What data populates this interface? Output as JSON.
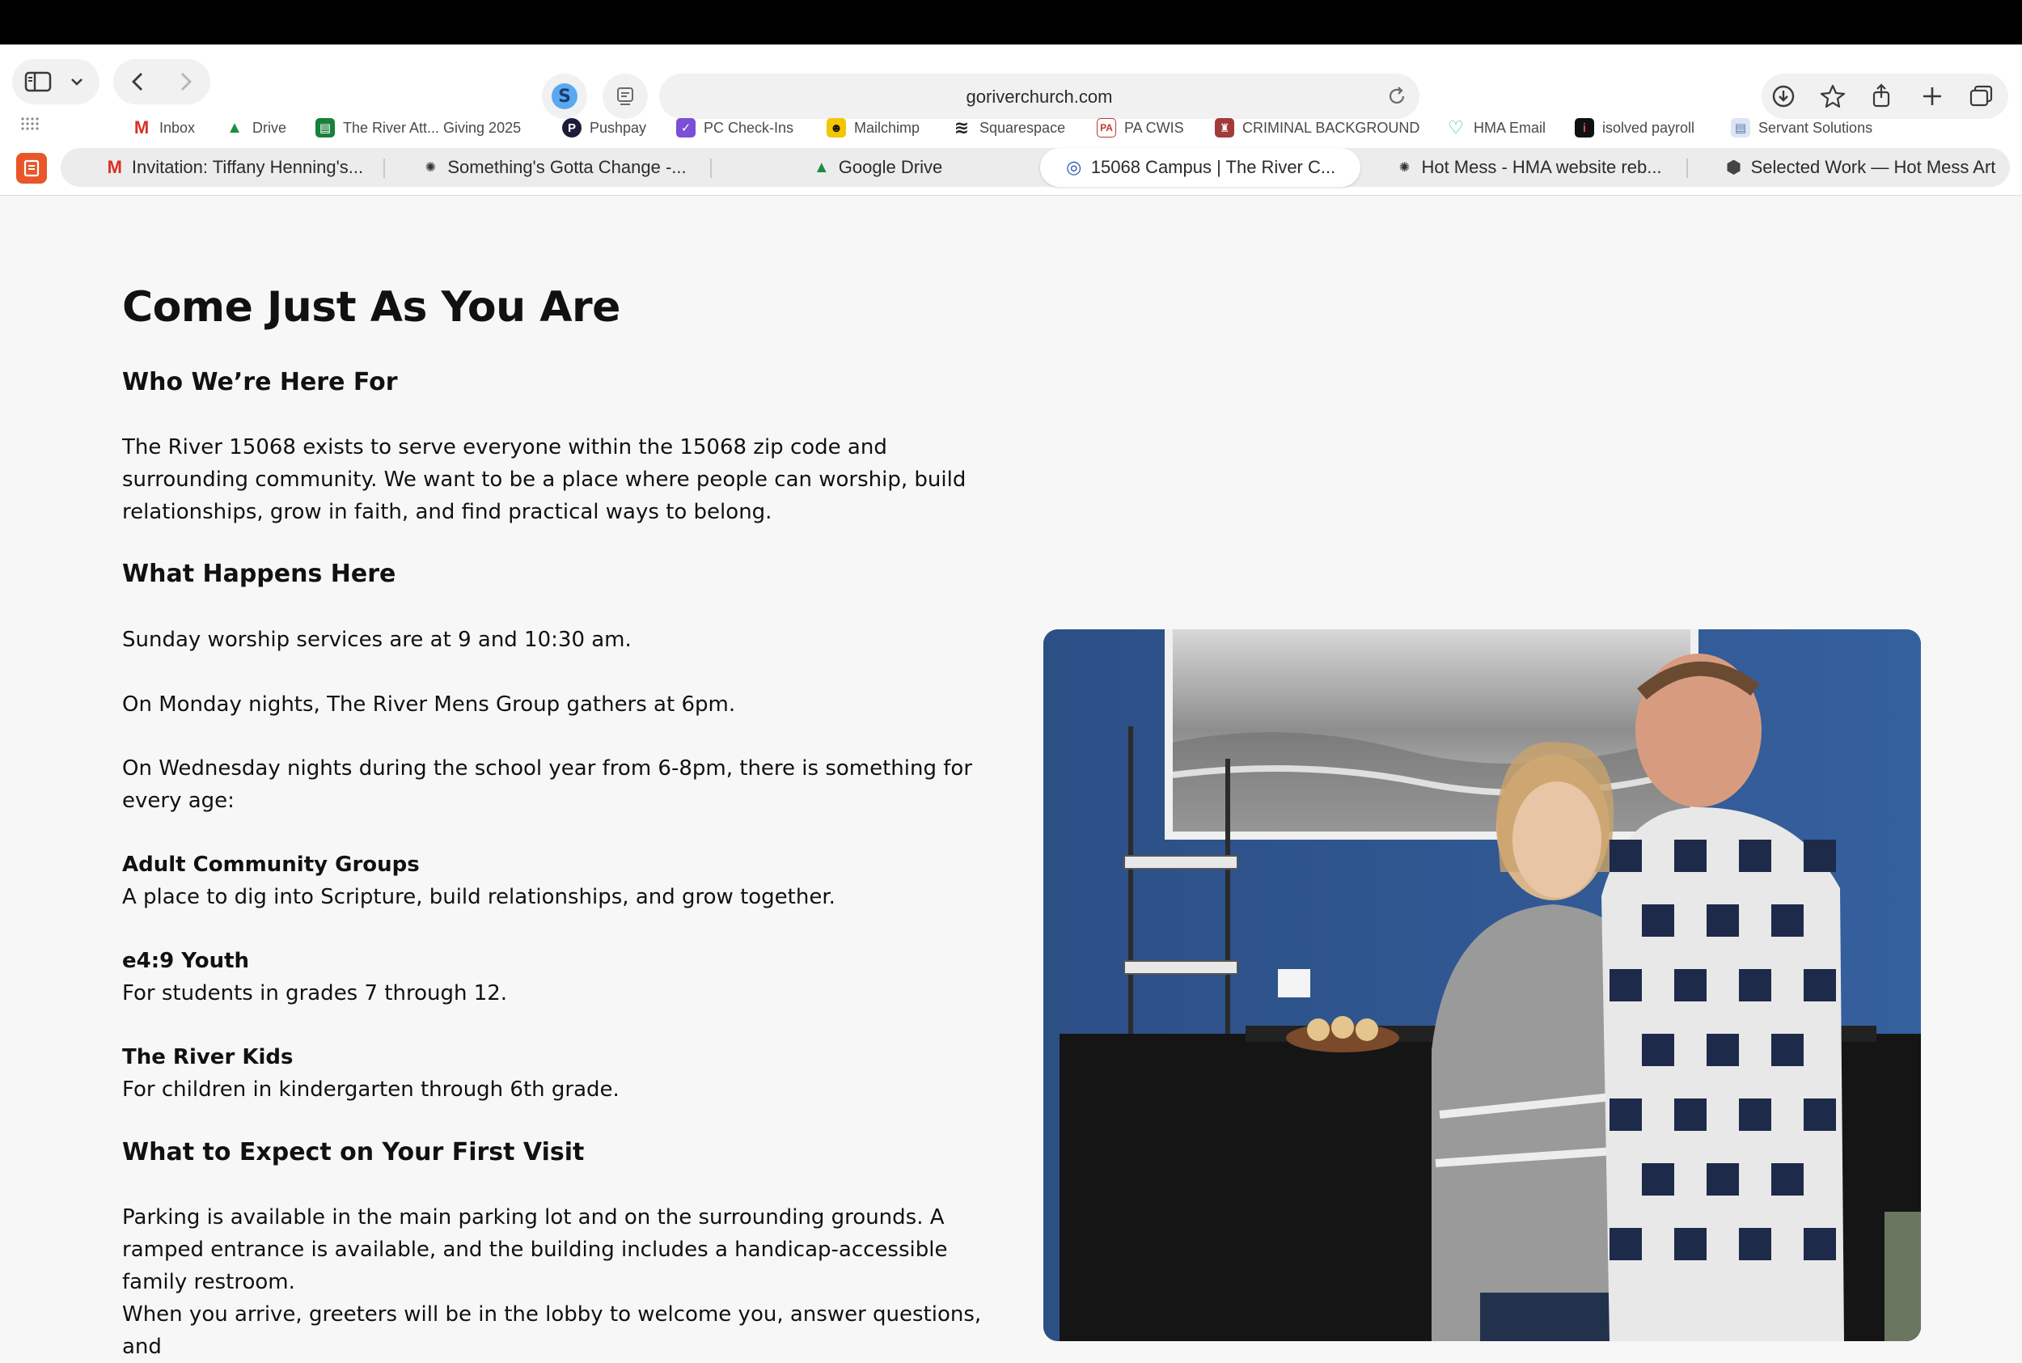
{
  "browser": {
    "url": "goriverchurch.com",
    "bookmarks": [
      {
        "label": "Inbox",
        "icon": "gmail-icon",
        "color": "#d93025",
        "glyph": "M"
      },
      {
        "label": "Drive",
        "icon": "google-drive-icon",
        "color": "#1e8e3e",
        "glyph": "▲"
      },
      {
        "label": "The River Att... Giving 2025",
        "icon": "sheets-icon",
        "color": "#188038",
        "glyph": "▤"
      },
      {
        "label": "Pushpay",
        "icon": "pushpay-icon",
        "color": "#1c1c3a",
        "glyph": "P"
      },
      {
        "label": "PC Check-Ins",
        "icon": "checkins-icon",
        "color": "#7b4fd6",
        "glyph": "✓"
      },
      {
        "label": "Mailchimp",
        "icon": "mailchimp-icon",
        "color": "#f2c700",
        "glyph": "☻"
      },
      {
        "label": "Squarespace",
        "icon": "squarespace-icon",
        "color": "#222222",
        "glyph": "≋"
      },
      {
        "label": "PA CWIS",
        "icon": "pa-cwis-icon",
        "color": "#c0392b",
        "glyph": "PA"
      },
      {
        "label": "CRIMINAL BACKGROUND",
        "icon": "criminal-background-icon",
        "color": "#a33a3a",
        "glyph": "♜"
      },
      {
        "label": "HMA Email",
        "icon": "hma-email-icon",
        "color": "#39b6b6",
        "glyph": "♡"
      },
      {
        "label": "isolved payroll",
        "icon": "isolved-icon",
        "color": "#111111",
        "glyph": "i"
      },
      {
        "label": "Servant Solutions",
        "icon": "document-icon",
        "color": "#8aa0c8",
        "glyph": "▤"
      }
    ],
    "tabs": [
      {
        "label": "Invitation: Tiffany Henning's...",
        "icon": "gmail-icon",
        "glyph": "M",
        "color": "#d93025"
      },
      {
        "label": "Something's Gotta Change -...",
        "icon": "openai-icon",
        "glyph": "✺",
        "color": "#333333"
      },
      {
        "label": "Google Drive",
        "icon": "google-drive-icon",
        "glyph": "▲",
        "color": "#1e8e3e"
      },
      {
        "label": "15068 Campus | The River C...",
        "icon": "river-logo-icon",
        "glyph": "◎",
        "color": "#2b5aa8"
      },
      {
        "label": "Hot Mess - HMA website reb...",
        "icon": "openai-icon",
        "glyph": "✺",
        "color": "#333333"
      },
      {
        "label": "Selected Work — Hot Mess Art",
        "icon": "cube-icon",
        "glyph": "⬢",
        "color": "#444444"
      }
    ]
  },
  "page": {
    "title": "Come Just As You Are",
    "sections": {
      "who_heading": "Who We’re Here For",
      "who_text": "The River 15068 exists to serve everyone within the 15068 zip code and surrounding community. We want to be a place where people can worship, build relationships, grow in faith, and find practical ways to belong.",
      "what_heading": "What Happens Here",
      "sunday": "Sunday worship services are at 9 and 10:30 am.",
      "monday": "On Monday nights, The River Mens Group gathers at 6pm.",
      "wednesday": "On Wednesday nights during the school year from 6-8pm, there is something for every age:",
      "groups": [
        {
          "name": "Adult Community Groups",
          "desc": "A place to dig into Scripture, build relationships, and grow together."
        },
        {
          "name": "e4:9 Youth",
          "desc": "For students in grades 7 through 12."
        },
        {
          "name": "The River Kids",
          "desc": "For children in kindergarten through 6th grade."
        }
      ],
      "expect_heading": "What to Expect on Your First Visit",
      "parking": "Parking is available in the main parking lot and on the surrounding grounds. A ramped entrance is available, and the building includes a handicap-accessible family restroom.",
      "arrive": "When you arrive, greeters will be in the lobby to welcome you, answer questions, and"
    }
  }
}
